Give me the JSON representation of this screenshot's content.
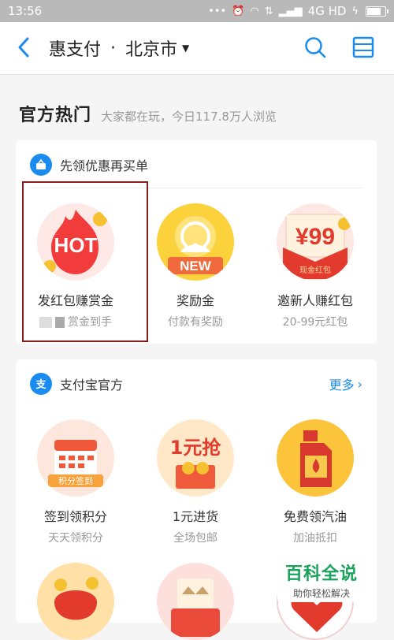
{
  "status": {
    "time": "13:56",
    "network": "4G HD"
  },
  "nav": {
    "title": "惠支付",
    "separator": "·",
    "city": "北京市"
  },
  "section": {
    "title": "官方热门",
    "subtitle": "大家都在玩，今日117.8万人浏览"
  },
  "card1": {
    "title": "先领优惠再买单",
    "items": [
      {
        "title": "发红包赚赏金",
        "subtitle": "赏金到手",
        "badge": "HOT"
      },
      {
        "title": "奖励金",
        "subtitle": "付款有奖励",
        "badge": "NEW"
      },
      {
        "title": "邀新人赚红包",
        "subtitle": "20-99元红包",
        "badge": "¥99",
        "tag": "现金红包"
      }
    ]
  },
  "card2": {
    "title": "支付宝官方",
    "more": "更多",
    "items": [
      {
        "title": "签到领积分",
        "subtitle": "天天领积分",
        "badge": "积分签到"
      },
      {
        "title": "1元进货",
        "subtitle": "全场包邮",
        "badge": "1元抢"
      },
      {
        "title": "免费领汽油",
        "subtitle": "加油抵扣"
      }
    ]
  },
  "watermark": {
    "title": "百科全说",
    "subtitle": "助你轻松解决"
  }
}
